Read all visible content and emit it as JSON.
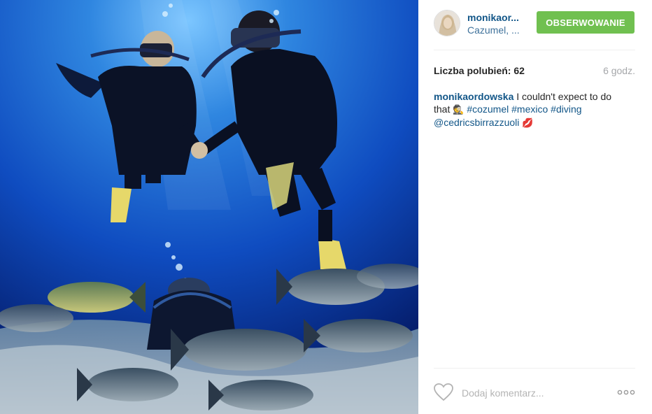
{
  "post": {
    "image_alt": "Scuba divers holding hands underwater surrounded by fish",
    "header": {
      "username": "monikaor...",
      "location": "Cazumel, ...",
      "follow_label": "OBSERWOWANIE"
    },
    "stats": {
      "likes": "Liczba polubień: 62",
      "time": "6 godz."
    },
    "caption": {
      "user": "monikaordowska",
      "text_1": " I couldn't expect to do that ",
      "emoji_1": "🕵",
      "hashtags": [
        "#cozumel",
        "#mexico",
        "#diving"
      ],
      "mention": "@cedricsbirrazzuoli",
      "emoji_2": "💋"
    },
    "footer": {
      "comment_placeholder": "Dodaj komentarz...",
      "like_icon": "heart-icon",
      "more_icon": "more-options-icon"
    }
  },
  "colors": {
    "follow_button": "#70c050",
    "link": "#125688",
    "muted": "#a5a7aa",
    "ocean_deep": "#0a2a8a",
    "ocean_light": "#3fa0e8"
  }
}
